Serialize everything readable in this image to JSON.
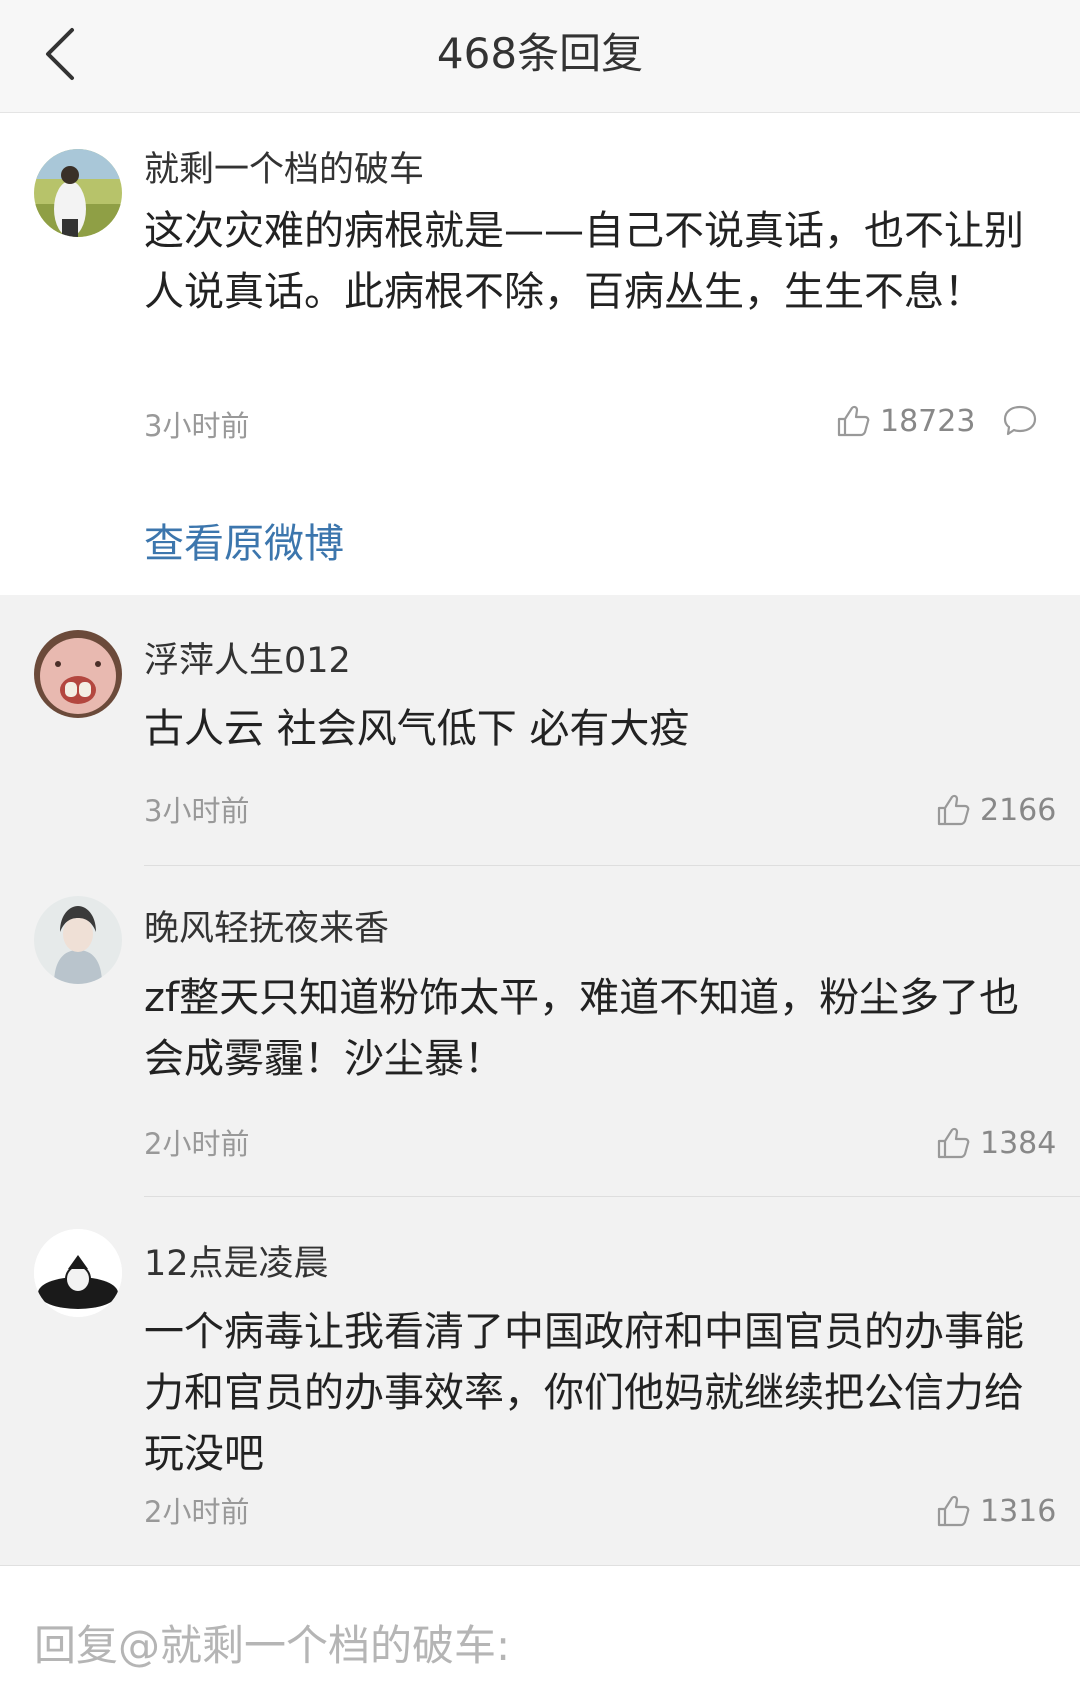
{
  "header": {
    "title": "468条回复"
  },
  "original": {
    "username": "就剩一个档的破车",
    "content": "这次灾难的病根就是——自己不说真话，也不让别人说真话。此病根不除，百病丛生，生生不息！",
    "time": "3小时前",
    "likes": "18723",
    "view_original": "查看原微博"
  },
  "replies": [
    {
      "username": "浮萍人生012",
      "content": "古人云 社会风气低下 必有大疫",
      "time": "3小时前",
      "likes": "2166"
    },
    {
      "username": "晚风轻抚夜来香",
      "content": "zf整天只知道粉饰太平，难道不知道，粉尘多了也会成雾霾！沙尘暴！",
      "time": "2小时前",
      "likes": "1384"
    },
    {
      "username": "12点是凌晨",
      "content": "一个病毒让我看清了中国政府和中国官员的办事能力和官员的办事效率，你们他妈就继续把公信力给玩没吧",
      "time": "2小时前",
      "likes": "1316"
    }
  ],
  "composer": {
    "placeholder": "回复@就剩一个档的破车:"
  }
}
